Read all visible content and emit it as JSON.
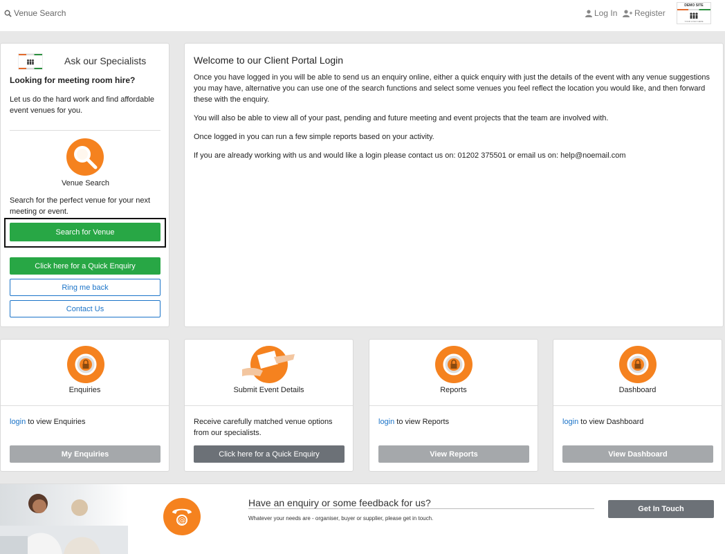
{
  "topbar": {
    "venue_search": "Venue Search",
    "login": "Log In",
    "register": "Register",
    "logo_title": "DEMO SITE",
    "logo_sub": "YOUR LOGO HERE"
  },
  "sidebar": {
    "heading": "Ask our Specialists",
    "looking": "Looking for meeting room hire?",
    "letus": "Let us do the hard work and find affordable event venues for you.",
    "venue_search_label": "Venue Search",
    "venue_search_desc": "Search for the perfect venue for your next meeting or event.",
    "search_button": "Search for Venue",
    "quick_enquiry_button": "Click here for a Quick Enquiry",
    "ring_button": "Ring me back",
    "contact_button": "Contact Us"
  },
  "welcome": {
    "title": "Welcome to our Client Portal Login",
    "p1": "Once you have logged in you will be able to send us an enquiry online, either a quick enquiry with just the details of the event with any venue suggestions you may have, alternative you can use one of the search functions and select some venues you feel reflect the location you would like, and then forward these with the enquiry.",
    "p2": "You will also be able to view all of your past, pending and future meeting and event projects that the team are involved with.",
    "p3": "Once logged in you can run a few simple reports based on your activity.",
    "p4": "If you are already working with us and would like a login please contact us on: 01202 375501 or email us on: help@noemail.com"
  },
  "cards": [
    {
      "label": "Enquiries",
      "link": "login",
      "text": " to view Enquiries",
      "button": "My Enquiries"
    },
    {
      "label": "Submit Event Details",
      "text": "Receive carefully matched venue options from our specialists.",
      "button": "Click here for a Quick Enquiry"
    },
    {
      "label": "Reports",
      "link": "login",
      "text": " to view Reports",
      "button": "View Reports"
    },
    {
      "label": "Dashboard",
      "link": "login",
      "text": " to view Dashboard",
      "button": "View Dashboard"
    }
  ],
  "banner": {
    "title": "Have an enquiry or some feedback for us?",
    "subtitle": "Whatever your needs are - organiser, buyer or supplier, please get in touch.",
    "button": "Get In Touch"
  },
  "colors": {
    "accent_orange": "#f5821f",
    "green": "#28a745",
    "link_blue": "#1a73c8",
    "grey_button": "#a5a8ab",
    "dark_button": "#6c7177"
  }
}
